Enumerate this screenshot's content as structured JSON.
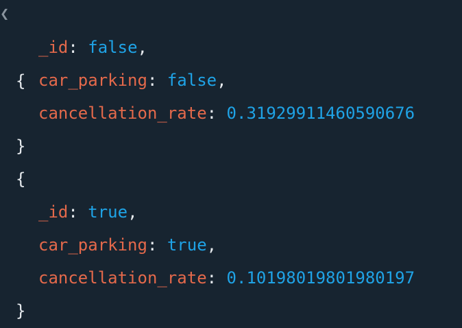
{
  "documents": [
    {
      "open_brace": "{",
      "close_brace": "}",
      "fields": [
        {
          "key": "_id",
          "value": "false",
          "type": "boolean",
          "trailing": ","
        },
        {
          "key": "car_parking",
          "value": "false",
          "type": "boolean",
          "trailing": ","
        },
        {
          "key": "cancellation_rate",
          "value": "0.31929911460590676",
          "type": "number",
          "trailing": ""
        }
      ]
    },
    {
      "open_brace": "{",
      "close_brace": "}",
      "fields": [
        {
          "key": "_id",
          "value": "true",
          "type": "boolean",
          "trailing": ","
        },
        {
          "key": "car_parking",
          "value": "true",
          "type": "boolean",
          "trailing": ","
        },
        {
          "key": "cancellation_rate",
          "value": "0.10198019801980197",
          "type": "number",
          "trailing": ""
        }
      ]
    }
  ],
  "colors": {
    "background": "#172430",
    "key": "#e4694b",
    "value": "#1fa3e6",
    "punctuation": "#e6eaee"
  },
  "icons": {
    "collapse": "chevron-left-icon"
  }
}
